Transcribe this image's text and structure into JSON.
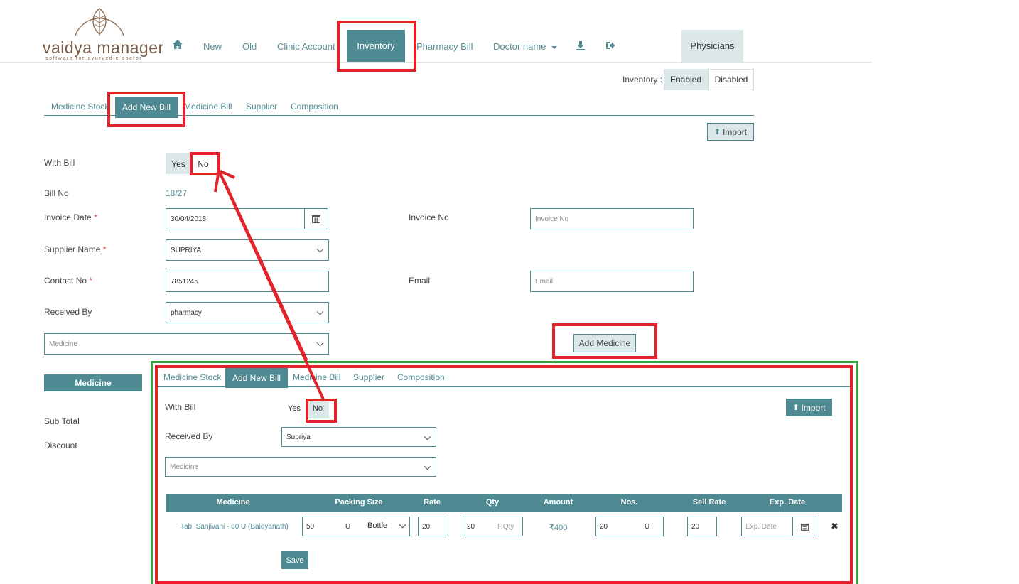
{
  "logo": {
    "name": "vaidya manager",
    "tagline": "software for ayurvedic doctor"
  },
  "nav": {
    "home_icon": "home-icon",
    "items": [
      "New",
      "Old",
      "Clinic Account",
      "Inventory",
      "Pharmacy Bill",
      "Doctor name"
    ],
    "download_icon": "download-icon",
    "logout_icon": "logout-icon",
    "physicians": "Physicians"
  },
  "inventory_toggle": {
    "label": "Inventory :",
    "enabled": "Enabled",
    "disabled": "Disabled"
  },
  "tabs": [
    "Medicine Stock",
    "Add New Bill",
    "Medicine Bill",
    "Supplier",
    "Composition"
  ],
  "import_label": "Import",
  "form": {
    "with_bill_label": "With Bill",
    "yes": "Yes",
    "no": "No",
    "bill_no_label": "Bill No",
    "bill_no_value": "18/27",
    "invoice_date_label": "Invoice Date",
    "invoice_date_value": "30/04/2018",
    "invoice_no_label": "Invoice No",
    "invoice_no_placeholder": "Invoice No",
    "supplier_label": "Supplier Name",
    "supplier_value": "SUPRIYA",
    "contact_label": "Contact No",
    "contact_value": "7851245",
    "email_label": "Email",
    "email_placeholder": "Email",
    "received_label": "Received By",
    "received_value": "pharmacy",
    "medicine_placeholder": "Medicine",
    "add_medicine": "Add Medicine",
    "required_mark": "*"
  },
  "summary": {
    "medicine_header": "Medicine",
    "sub_total": "Sub Total",
    "discount": "Discount"
  },
  "inset": {
    "tabs": [
      "Medicine Stock",
      "Add New Bill",
      "Medicine Bill",
      "Supplier",
      "Composition"
    ],
    "with_bill_label": "With Bill",
    "yes": "Yes",
    "no": "No",
    "import_label": "Import",
    "received_label": "Received By",
    "received_value": "Supriya",
    "medicine_placeholder": "Medicine",
    "table_headers": [
      "Medicine",
      "Packing Size",
      "Rate",
      "Qty",
      "Amount",
      "Nos.",
      "Sell Rate",
      "Exp. Date"
    ],
    "row": {
      "medicine": "Tab. Sanjivani - 60 U (Baidyanath)",
      "packing_qty": "50",
      "packing_unit": "U",
      "packing_type": "Bottle",
      "rate": "20",
      "qty": "20",
      "free_qty_placeholder": "F.Qty",
      "amount": "₹400",
      "nos": "20",
      "nos_unit": "U",
      "sell_rate": "20",
      "exp_placeholder": "Exp. Date"
    },
    "save": "Save"
  },
  "colors": {
    "accent": "#4f8a92",
    "annotation_red": "#e3232b",
    "annotation_green": "#2daa3a"
  }
}
